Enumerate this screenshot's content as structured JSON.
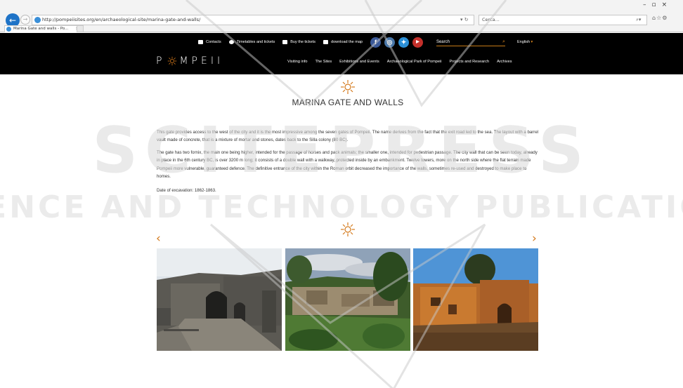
{
  "browser": {
    "url": "http://pompeiisites.org/en/archaeological-site/marina-gate-and-walls/",
    "search_placeholder": "Cerca...",
    "tab_title": "Marina Gate and walls - Po..."
  },
  "topbar": {
    "contacts": "Contacts",
    "timetables": "Timetables and tickets",
    "buy": "Buy the tickets",
    "map": "download the map",
    "search_placeholder": "Search",
    "language": "English"
  },
  "logo": {
    "left": "P",
    "right": "MPEII"
  },
  "nav": [
    "Visiting info",
    "The Sites",
    "Exhibitions and Events",
    "Archaeological Park of Pompeii",
    "Projects and Research",
    "Archives"
  ],
  "page": {
    "title": "MARINA GATE AND WALLS",
    "p1": "This gate provides access to the west of the city and it is the most impressive among the seven gates of Pompeii. The name derives from the fact that the exit road led to the sea. The layout with a barrel vault made of concrete, that is a mixture of mortar and stones, dates back to the Silla colony (80 BC).",
    "p2": "The gate has two fornix, the main one being higher, intended for the passage of horses and pack animals; the smaller one, intended for pedestrian passage. The city wall that can be seen today, already in place in the 6th century BC, is over 3200 m long; it consists of a double wall with a walkway, protected inside by an embankment. Twelve towers, more on the north side where the flat terrain made Pompeii more vulnerable, guaranteed defence. The definitive entrance of the city within the Roman orbit decreased the importance of the walls, sometimes re-used and destroyed to make place to homes.",
    "p3": "Date of excavation: 1862-1863."
  },
  "gallery": {
    "prev": "‹",
    "next": "›"
  },
  "watermark": {
    "line1": "SCITEPRESS",
    "line2": "SCIENCE AND TECHNOLOGY PUBLICATIONS"
  },
  "colors": {
    "accent": "#d4791b",
    "header_bg": "#000000"
  }
}
